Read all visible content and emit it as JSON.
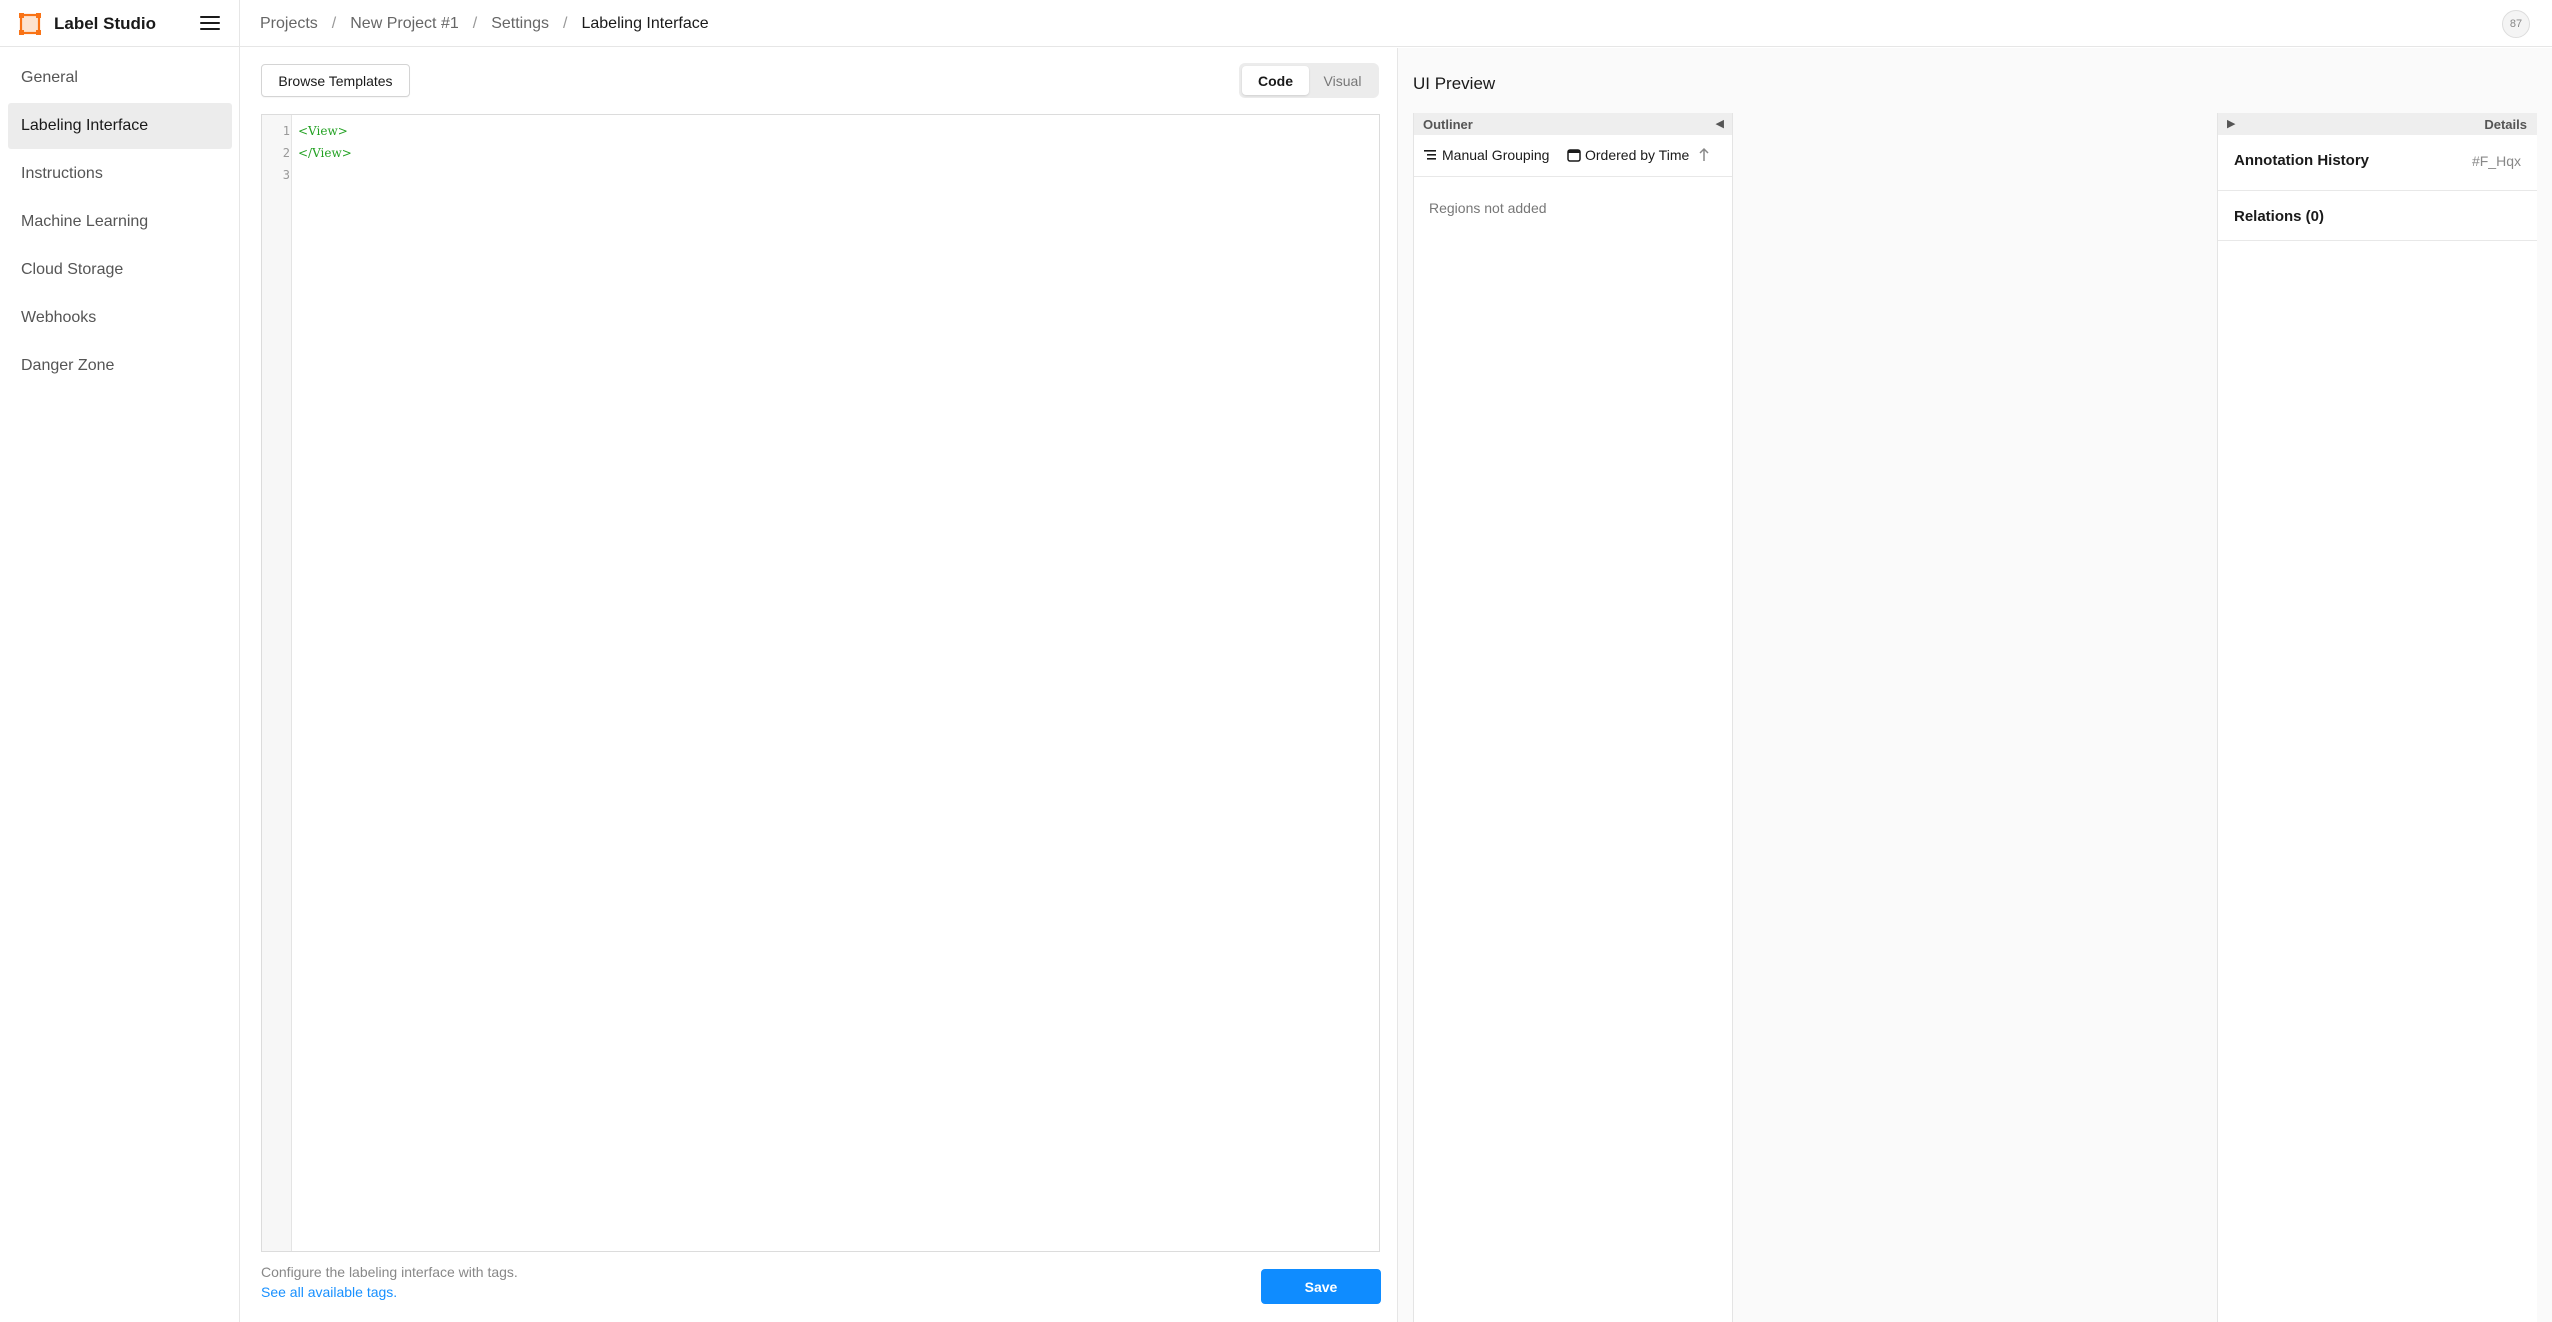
{
  "app": {
    "name": "Label Studio",
    "accent_color": "#f97316",
    "primary_color": "#0f8cff"
  },
  "breadcrumb": {
    "items": [
      "Projects",
      "New Project #1",
      "Settings",
      "Labeling Interface"
    ],
    "separator": "/"
  },
  "user": {
    "avatar_text": "87"
  },
  "sidebar": {
    "items": [
      {
        "label": "General",
        "active": false
      },
      {
        "label": "Labeling Interface",
        "active": true
      },
      {
        "label": "Instructions",
        "active": false
      },
      {
        "label": "Machine Learning",
        "active": false
      },
      {
        "label": "Cloud Storage",
        "active": false
      },
      {
        "label": "Webhooks",
        "active": false
      },
      {
        "label": "Danger Zone",
        "active": false
      }
    ]
  },
  "editor": {
    "browse_label": "Browse Templates",
    "modes": {
      "code": "Code",
      "visual": "Visual",
      "active": "code"
    },
    "line_numbers": [
      "1",
      "2",
      "3"
    ],
    "code_lines": [
      "<View>",
      "</View>",
      ""
    ],
    "hint": "Configure the labeling interface with tags.",
    "link": "See all available tags.",
    "save_label": "Save"
  },
  "preview": {
    "title": "UI Preview",
    "outliner": {
      "title": "Outliner",
      "grouping_label": "Manual Grouping",
      "order_label": "Ordered by Time",
      "empty_text": "Regions not added"
    },
    "details": {
      "title": "Details",
      "annotation_history": "Annotation History",
      "annotation_id": "#F_Hqx",
      "relations": "Relations (0)"
    }
  }
}
